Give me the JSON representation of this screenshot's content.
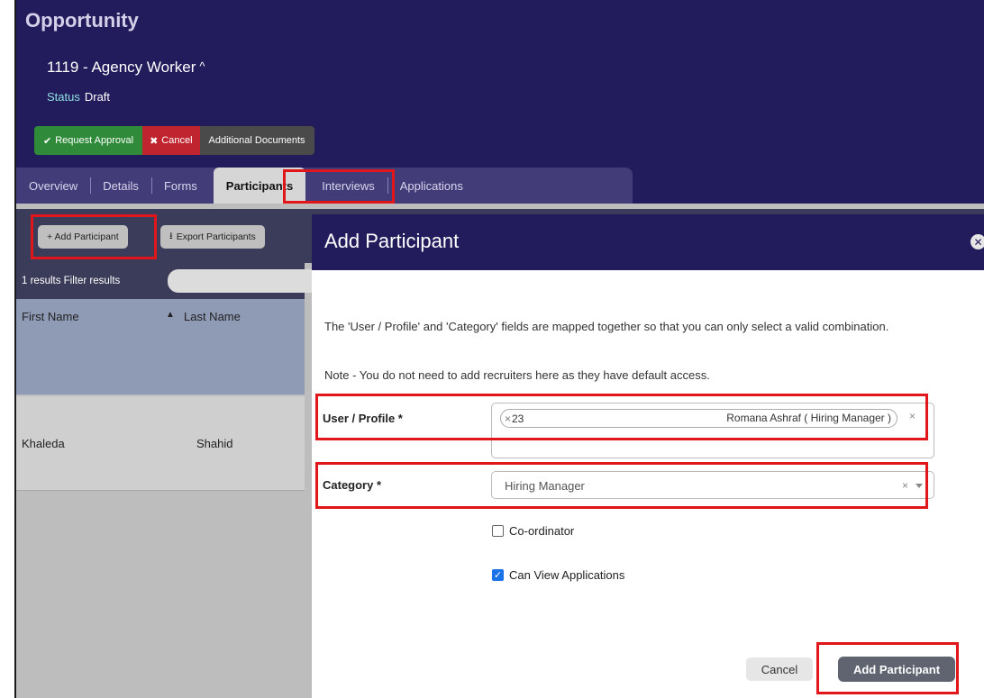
{
  "page": {
    "title": "Opportunity",
    "opportunity_name": "1119 - Agency Worker",
    "status_label": "Status",
    "status_value": "Draft"
  },
  "actions": {
    "request_approval": "Request Approval",
    "cancel": "Cancel",
    "additional_documents": "Additional Documents"
  },
  "tabs": [
    {
      "label": "Overview"
    },
    {
      "label": "Details"
    },
    {
      "label": "Forms"
    },
    {
      "label": "Participants"
    },
    {
      "label": "Interviews"
    },
    {
      "label": "Applications"
    }
  ],
  "active_tab": "Participants",
  "toolbar": {
    "add_participant": "+ Add Participant",
    "export_participants": "Export Participants"
  },
  "results": {
    "text": "1 results  Filter results"
  },
  "table": {
    "columns": [
      "First Name",
      "Last Name"
    ],
    "rows": [
      {
        "first_name": "Khaleda",
        "last_name": "Shahid"
      }
    ]
  },
  "modal": {
    "title": "Add Participant",
    "intro": "The 'User / Profile' and 'Category' fields are mapped together so that you can only select a valid combination.",
    "note": "Note - You do not need to add recruiters here as they have default access.",
    "user_profile_label": "User / Profile *",
    "user_tag_id": "23",
    "user_tag_name": "Romana Ashraf ( Hiring Manager )",
    "category_label": "Category *",
    "category_value": "Hiring Manager",
    "coordinator_label": "Co-ordinator",
    "coordinator_checked": false,
    "can_view_label": "Can View Applications",
    "can_view_checked": true,
    "cancel_label": "Cancel",
    "submit_label": "Add Participant"
  },
  "icons": {
    "close": "close-icon",
    "check": "check-icon",
    "cancel": "x-icon",
    "export": "download-icon",
    "chevron": "chevron-up-icon"
  },
  "colors": {
    "header": "#231c5c",
    "approve": "#2f8a3a",
    "cancel": "#c0242f",
    "highlight": "#e0161b",
    "checkbox": "#1a73e8"
  }
}
